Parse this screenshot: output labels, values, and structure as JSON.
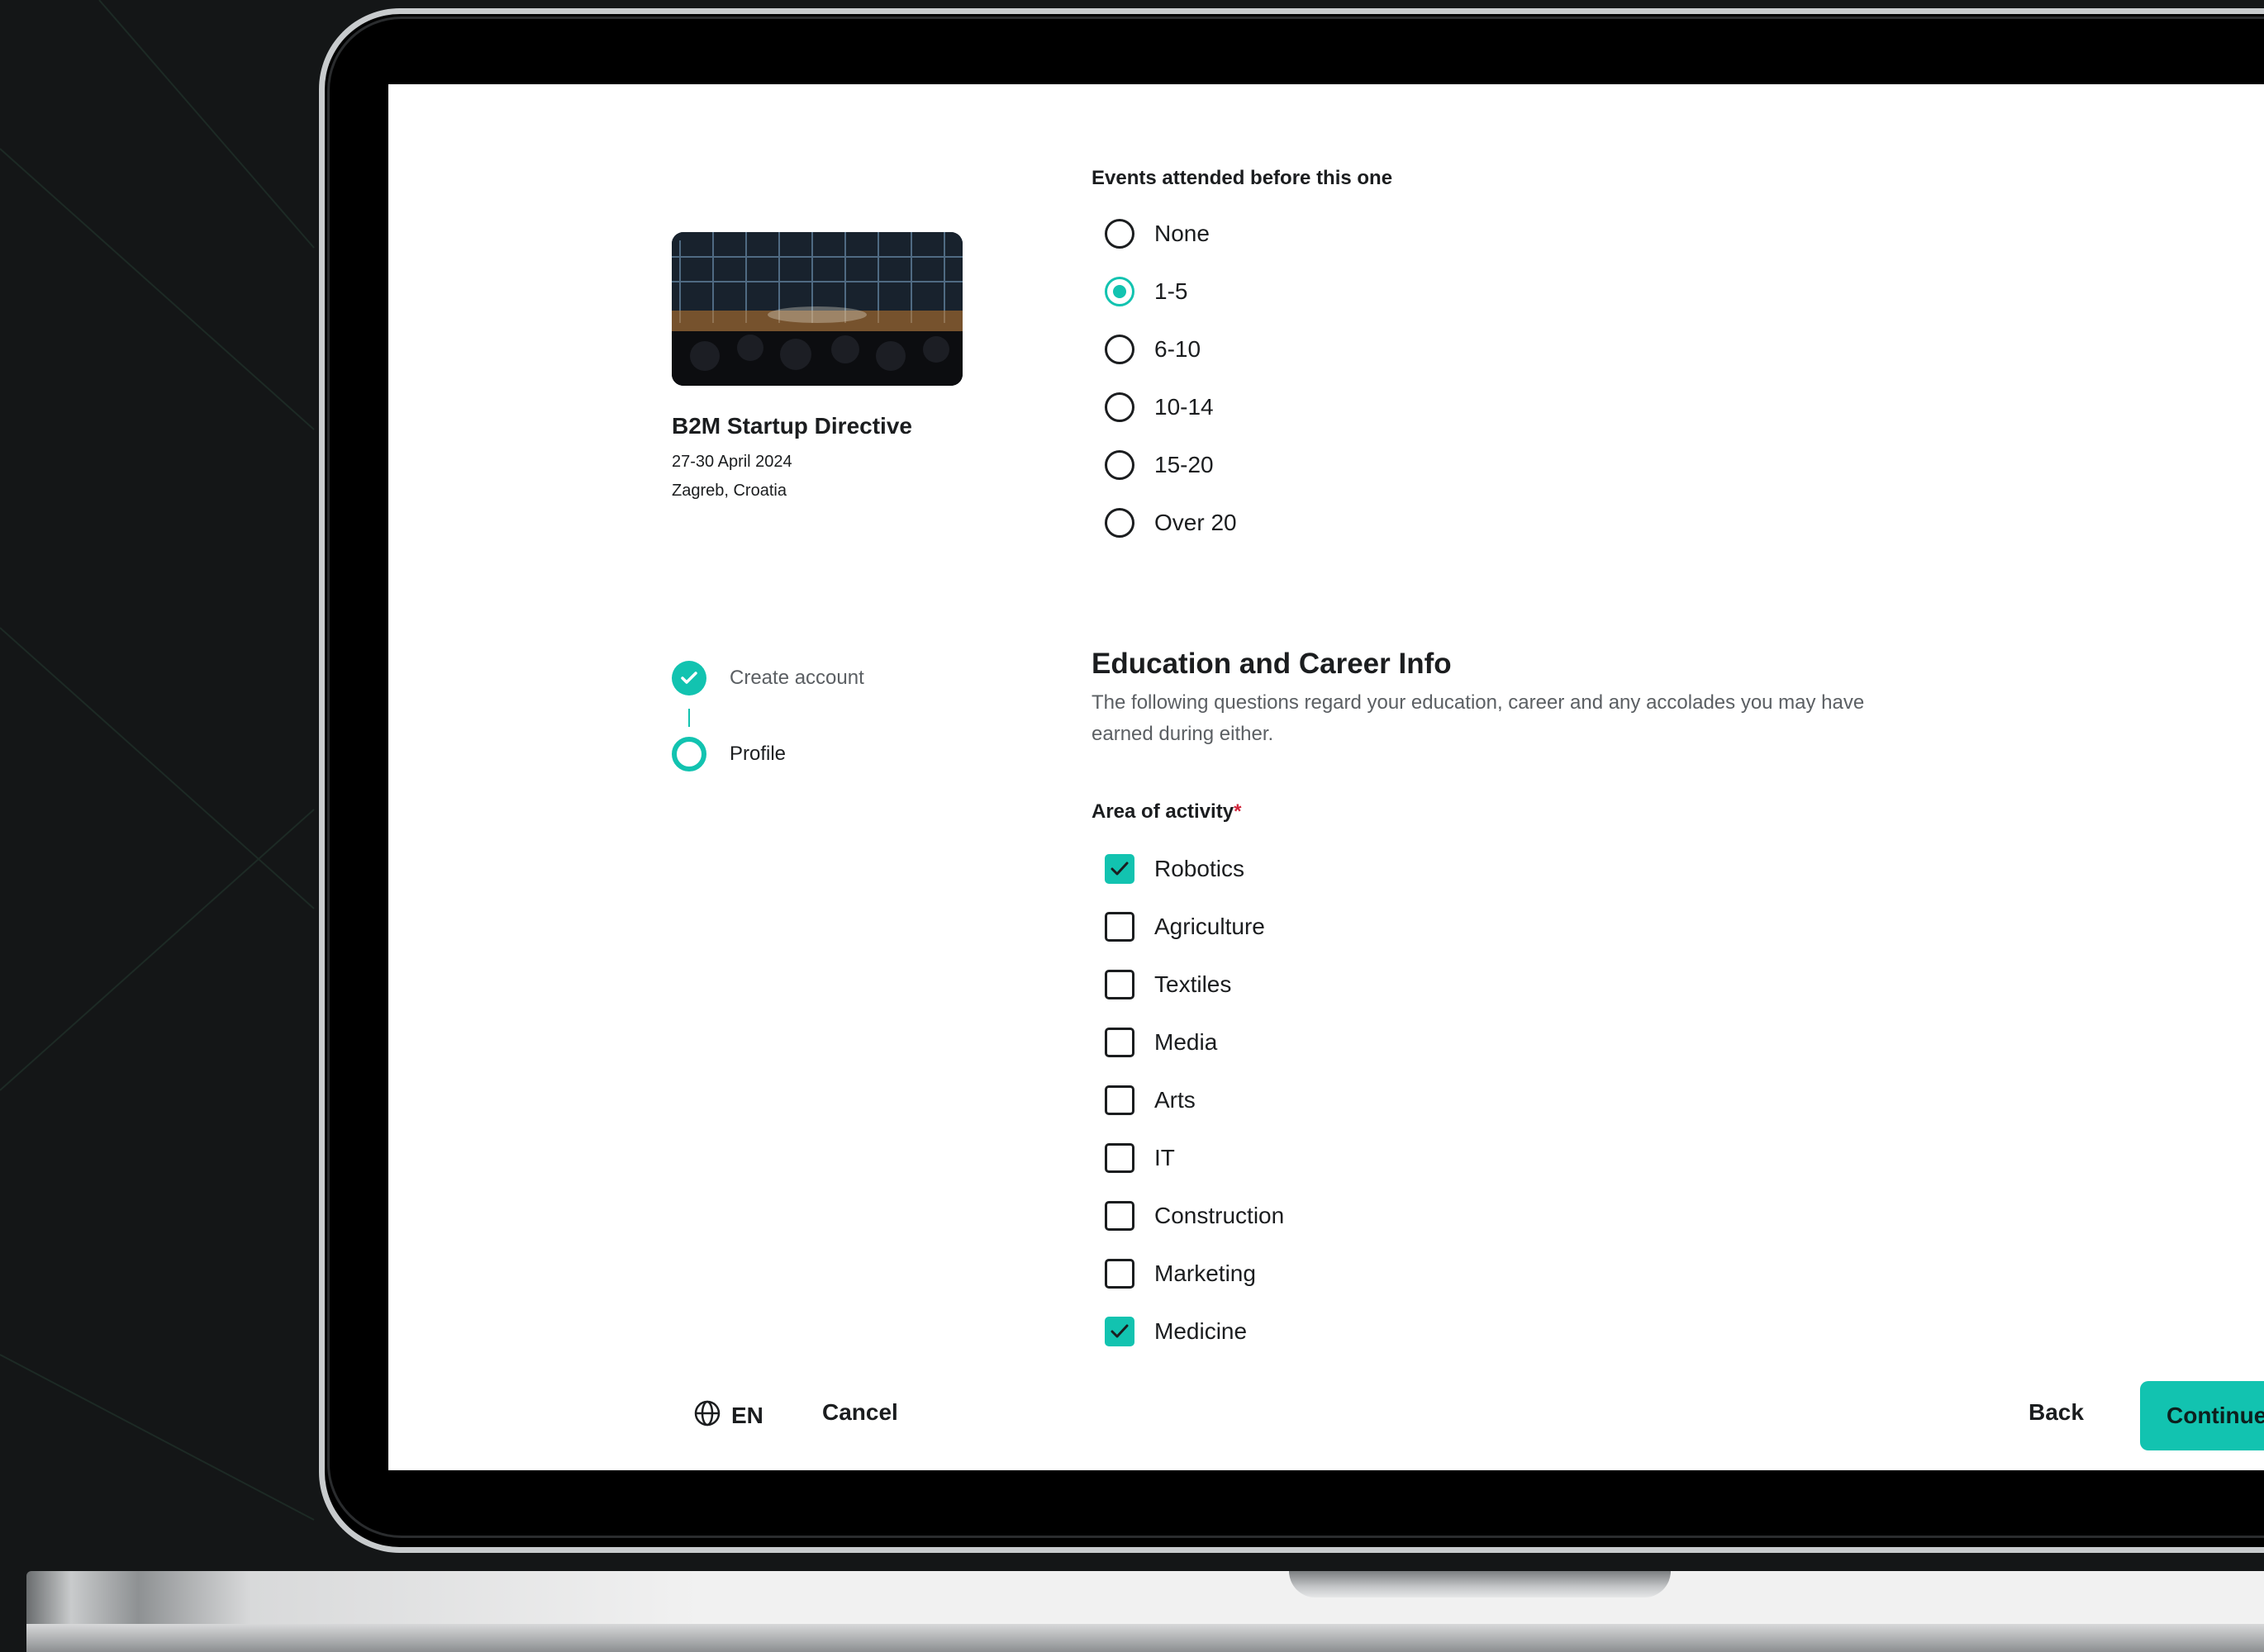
{
  "colors": {
    "accent": "#12c3b0",
    "required": "#d0243a",
    "text": "#1b1d1f",
    "muted": "#5b5f63"
  },
  "event": {
    "title": "B2M Startup Directive",
    "date": "27-30 April 2024",
    "location": "Zagreb, Croatia"
  },
  "stepper": {
    "steps": [
      {
        "label": "Create account",
        "status": "complete"
      },
      {
        "label": "Profile",
        "status": "current"
      }
    ]
  },
  "events_attended": {
    "label": "Events attended before this one",
    "options": [
      {
        "label": "None",
        "selected": false
      },
      {
        "label": "1-5",
        "selected": true
      },
      {
        "label": "6-10",
        "selected": false
      },
      {
        "label": "10-14",
        "selected": false
      },
      {
        "label": "15-20",
        "selected": false
      },
      {
        "label": "Over 20",
        "selected": false
      }
    ]
  },
  "education": {
    "title": "Education and Career Info",
    "description": "The following questions regard your education, career and any accolades you may have earned during either."
  },
  "area_of_activity": {
    "label": "Area of activity",
    "required_marker": "*",
    "options": [
      {
        "label": "Robotics",
        "checked": true
      },
      {
        "label": "Agriculture",
        "checked": false
      },
      {
        "label": "Textiles",
        "checked": false
      },
      {
        "label": "Media",
        "checked": false
      },
      {
        "label": "Arts",
        "checked": false
      },
      {
        "label": "IT",
        "checked": false
      },
      {
        "label": "Construction",
        "checked": false
      },
      {
        "label": "Marketing",
        "checked": false
      },
      {
        "label": "Medicine",
        "checked": true
      }
    ]
  },
  "footer": {
    "language": "EN",
    "language_icon": "globe-icon",
    "cancel_label": "Cancel",
    "back_label": "Back",
    "continue_label": "Continue"
  }
}
